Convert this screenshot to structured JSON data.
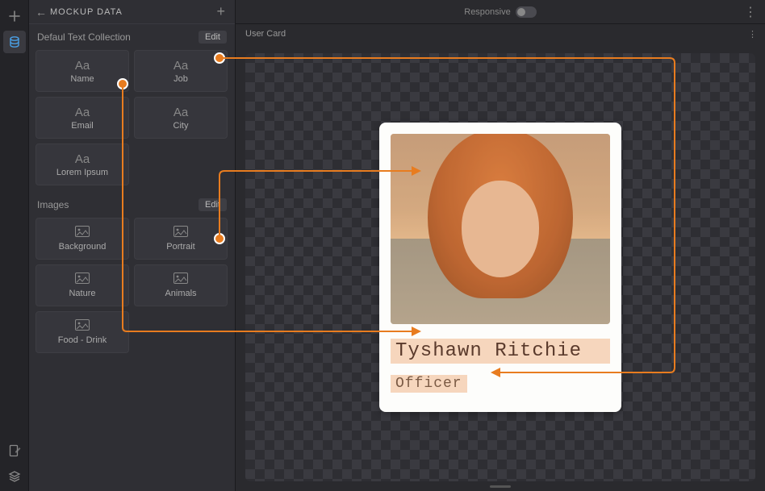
{
  "rail": {
    "items": [
      "plus",
      "data",
      "page-edit",
      "layers"
    ]
  },
  "sidebar": {
    "title": "MOCKUP DATA",
    "sections": [
      {
        "label": "Defaul Text Collection",
        "edit": "Edit",
        "tiles": [
          {
            "label": "Name",
            "icon": "Aa"
          },
          {
            "label": "Job",
            "icon": "Aa"
          },
          {
            "label": "Email",
            "icon": "Aa"
          },
          {
            "label": "City",
            "icon": "Aa"
          },
          {
            "label": "Lorem Ipsum",
            "icon": "Aa"
          }
        ]
      },
      {
        "label": "Images",
        "edit": "Edit",
        "tiles": [
          {
            "label": "Background",
            "icon": "image"
          },
          {
            "label": "Portrait",
            "icon": "image"
          },
          {
            "label": "Nature",
            "icon": "image"
          },
          {
            "label": "Animals",
            "icon": "image"
          },
          {
            "label": "Food - Drink",
            "icon": "image"
          }
        ]
      }
    ]
  },
  "canvas": {
    "responsive_label": "Responsive",
    "artboard_label": "User Card"
  },
  "user_card": {
    "name": "Tyshawn Ritchie",
    "role": "Officer"
  },
  "colors": {
    "accent": "#e87c1f",
    "highlight": "#f6d6bd"
  }
}
